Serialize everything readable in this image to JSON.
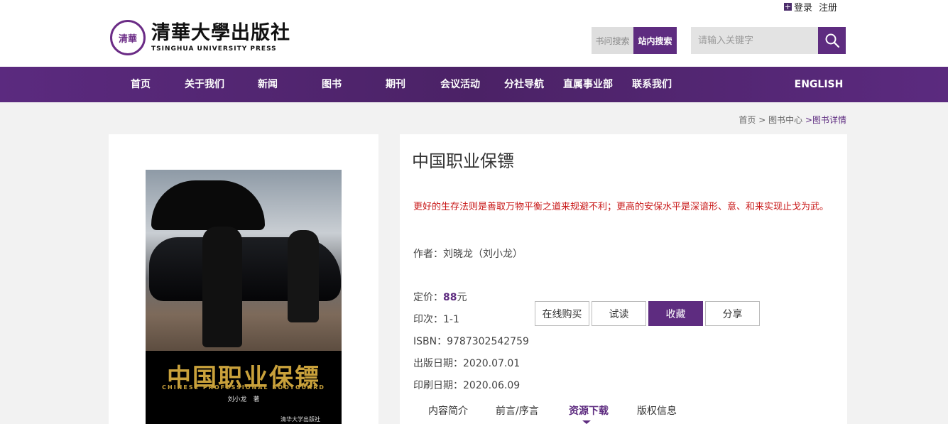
{
  "header": {
    "logo_cn": "清華大學出版社",
    "logo_en": "TSINGHUA UNIVERSITY PRESS",
    "seal_text": "清華",
    "login": "登录",
    "register": "注册",
    "search_tabs": [
      "书问搜索",
      "站内搜索"
    ],
    "search_placeholder": "请输入关键字"
  },
  "nav": {
    "items": [
      "首页",
      "关于我们",
      "新闻",
      "图书",
      "期刊",
      "会议活动",
      "分社导航",
      "直属事业部",
      "联系我们"
    ],
    "english": "ENGLISH"
  },
  "breadcrumb": {
    "home": "首页",
    "sep": ">",
    "center": "图书中心",
    "current": ">图书详情"
  },
  "cover": {
    "title": "中国职业保镖",
    "subtitle_en": "CHINESE PROFESSIONAL BODYGUARD",
    "author": "刘小龙　著",
    "publisher": "清华大学出版社"
  },
  "book": {
    "title": "中国职业保镖",
    "slogan": "更好的生存法则是善取万物平衡之道来规避不利；更高的安保水平是深谙形、意、和来实现止戈为武。",
    "author_label": "作者：",
    "author": "刘晓龙（刘小龙）",
    "price_label": "定价：",
    "price": "88",
    "price_unit": "元",
    "printing_label": "印次：",
    "printing": "1-1",
    "isbn_label": "ISBN：",
    "isbn": "9787302542759",
    "pub_date_label": "出版日期：",
    "pub_date": "2020.07.01",
    "print_date_label": "印刷日期：",
    "print_date": "2020.06.09"
  },
  "actions": [
    "在线购买",
    "试读",
    "收藏",
    "分享"
  ],
  "tabs": [
    "内容简介",
    "前言/序言",
    "资源下载",
    "版权信息"
  ],
  "colors": {
    "brand": "#5e2c80",
    "slogan": "#c81717"
  }
}
